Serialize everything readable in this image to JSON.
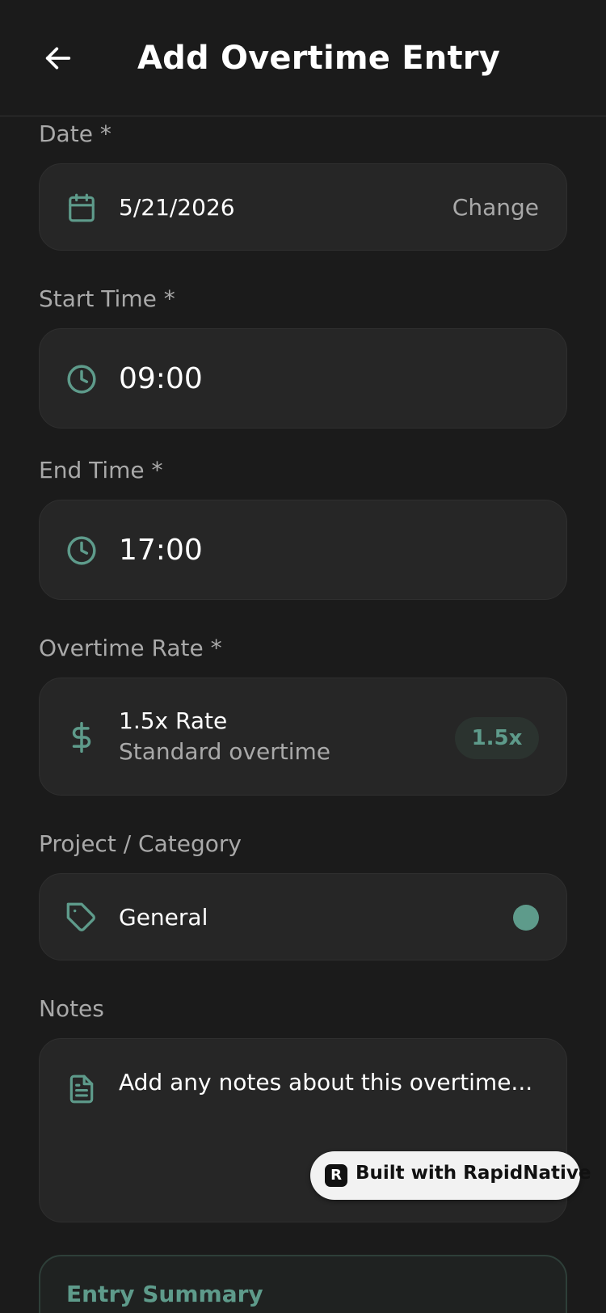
{
  "header": {
    "title": "Add Overtime Entry"
  },
  "fields": {
    "date": {
      "label": "Date *",
      "value": "5/21/2026",
      "action": "Change"
    },
    "start_time": {
      "label": "Start Time *",
      "value": "09:00"
    },
    "end_time": {
      "label": "End Time *",
      "value": "17:00"
    },
    "overtime_rate": {
      "label": "Overtime Rate *",
      "title": "1.5x Rate",
      "subtitle": "Standard overtime",
      "badge": "1.5x"
    },
    "project": {
      "label": "Project / Category",
      "value": "General",
      "color": "#5e9b8b"
    },
    "notes": {
      "label": "Notes",
      "placeholder": "Add any notes about this overtime..."
    }
  },
  "summary": {
    "title": "Entry Summary"
  },
  "built_with": {
    "label": "Built with RapidNative"
  },
  "colors": {
    "accent": "#5e9b8b",
    "background": "#1b1b1b",
    "card": "#262626",
    "muted_text": "#a9a9a9"
  },
  "icons": {
    "back": "arrow-left-icon",
    "date": "calendar-icon",
    "start_time": "clock-icon",
    "end_time": "clock-icon",
    "rate": "dollar-icon",
    "project": "tag-icon",
    "notes": "file-text-icon"
  }
}
